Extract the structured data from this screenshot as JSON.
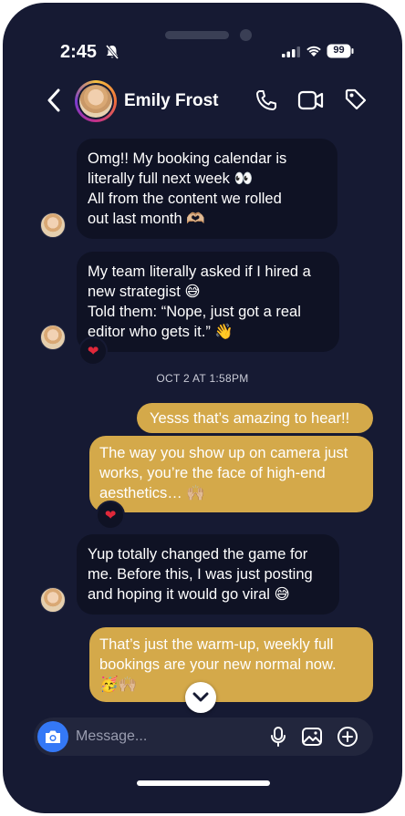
{
  "status_bar": {
    "time": "2:45",
    "battery": "99"
  },
  "header": {
    "contact_name": "Emily Frost"
  },
  "messages": [
    {
      "from": "them",
      "lines": [
        "Omg!! My booking calendar is",
        "literally full next week 👀",
        "All from the content we rolled",
        "out last month 🫶🏼"
      ]
    },
    {
      "from": "them",
      "lines": [
        "My team literally asked if I hired a",
        "new strategist 😅",
        "Told them: “Nope, just got a real",
        "editor who gets it.” 👋"
      ],
      "reaction": "❤"
    },
    {
      "from": "me",
      "lines": [
        "Yesss that’s amazing to hear!!"
      ]
    },
    {
      "from": "me",
      "lines": [
        "The way you show up on camera just",
        "works, you’re the face of high-end",
        "aesthetics… 🙌🏼"
      ],
      "reaction": "❤"
    },
    {
      "from": "them",
      "lines": [
        "Yup totally changed the game for",
        "me. Before this, I was just posting",
        "and hoping it would go viral 😅"
      ]
    },
    {
      "from": "me",
      "lines": [
        "That’s just the warm-up, weekly full",
        "bookings are your new normal now.",
        "🥳🙌🏼"
      ]
    }
  ],
  "timestamp": "OCT 2 AT 1:58PM",
  "composer": {
    "placeholder": "Message..."
  },
  "colors": {
    "background": "#161a33",
    "incoming_bubble": "#0f1224",
    "outgoing_bubble": "#d4a94a",
    "camera_button": "#3478f6"
  }
}
